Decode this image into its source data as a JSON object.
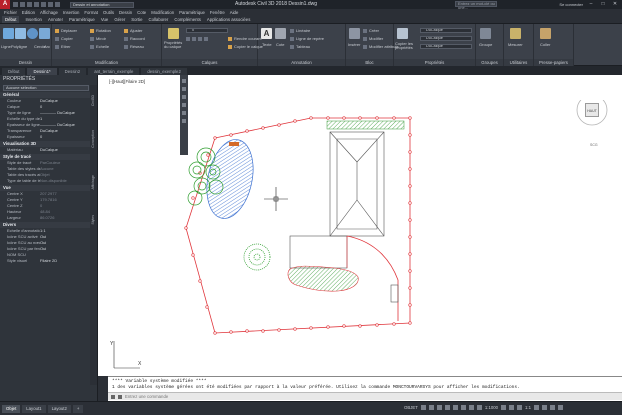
{
  "titlebar": {
    "logo": "A",
    "workspace": "Dessin et annotation",
    "title": "Autodesk Civil 3D 2018   Dessin1.dwg",
    "search_placeholder": "Entrez un mot-clé ou une...",
    "signin": "Se connecter"
  },
  "menubar": [
    "Fichier",
    "Edition",
    "Affichage",
    "Insertion",
    "Format",
    "Outils",
    "Dessin",
    "Cote",
    "Modification",
    "Paramétrique",
    "Fenêtre",
    "Aide"
  ],
  "ribbon_tabs": [
    "Début",
    "Insertion",
    "Annoter",
    "Paramétrique",
    "Vue",
    "Gérer",
    "Sortie",
    "Collaborer",
    "Compléments",
    "Applications associées"
  ],
  "ribbon": {
    "dessin": {
      "title": "Dessin",
      "items": [
        "Ligne",
        "Polyligne",
        "Cercle",
        "Arc"
      ]
    },
    "modification": {
      "title": "Modification",
      "items": [
        "Déplacer",
        "Rotation",
        "Ajuster",
        "Copier",
        "Miroir",
        "Raccord",
        "Etirer",
        "Echelle",
        "Réseau"
      ]
    },
    "calques": {
      "title": "Calques",
      "items": [
        "Propriétés du calque",
        "Rendre courant",
        "Copier le calque"
      ],
      "combo": "0"
    },
    "annotation": {
      "title": "Annotation",
      "items": [
        "Texte",
        "Cote",
        "Linéaire",
        "Ligne de repère",
        "Tableau"
      ]
    },
    "bloc": {
      "title": "Bloc",
      "items": [
        "Insérer",
        "Créer",
        "Modifier",
        "Modifier attributs"
      ]
    },
    "proprietes": {
      "title": "Propriétés",
      "items": [
        "Copier les propriétés"
      ],
      "combos": [
        "DuCalque",
        "DuCalque",
        "DuCalque"
      ]
    },
    "groupes": {
      "title": "Groupes",
      "items": [
        "Groupe"
      ]
    },
    "utilitaires": {
      "title": "Utilitaires",
      "items": [
        "Mesurer"
      ]
    },
    "presse": {
      "title": "Presse-papiers",
      "items": [
        "Coller"
      ]
    }
  },
  "doctabs": [
    "Début",
    "Dessin1*",
    "Dessin2",
    "ant_terrain_exemple",
    "dessin_exemple2"
  ],
  "properties": {
    "header": "PROPRIÉTÉS",
    "selection": "Aucune sélection",
    "sections": [
      {
        "title": "Général",
        "rows": [
          {
            "k": "Couleur",
            "v": "DuCalque"
          },
          {
            "k": "Calque",
            "v": "0"
          },
          {
            "k": "Type de ligne",
            "v": "———— DuCalque"
          },
          {
            "k": "Echelle du type de li...",
            "v": "1"
          },
          {
            "k": "Epaisseur de ligne",
            "v": "———— DuCalque"
          },
          {
            "k": "Transparence",
            "v": "DuCalque"
          },
          {
            "k": "Epaisseur",
            "v": "0"
          }
        ]
      },
      {
        "title": "Visualisation 3D",
        "rows": [
          {
            "k": "Matériau",
            "v": "DuCalque"
          }
        ]
      },
      {
        "title": "Style de tracé",
        "rows": [
          {
            "k": "Style de tracé",
            "v": "ParCouleur"
          },
          {
            "k": "Table des styles de tr...",
            "v": "Aucune"
          },
          {
            "k": "Table des tracés atta...",
            "v": "Objet"
          },
          {
            "k": "Type de table de tra...",
            "v": "Non-disponible"
          }
        ]
      },
      {
        "title": "Vue",
        "rows": [
          {
            "k": "Centre X",
            "v": "207.2977"
          },
          {
            "k": "Centre Y",
            "v": "179.7816"
          },
          {
            "k": "Centre Z",
            "v": "0"
          },
          {
            "k": "Hauteur",
            "v": "48.84"
          },
          {
            "k": "Largeur",
            "v": "86.0726"
          }
        ]
      },
      {
        "title": "Divers",
        "rows": [
          {
            "k": "Echelle d'annotation",
            "v": "1:1"
          },
          {
            "k": "Icône SCU activé",
            "v": "Oui"
          },
          {
            "k": "Icône SCU au nœud...",
            "v": "Oui"
          },
          {
            "k": "Icône SCU par fenêt...",
            "v": "Oui"
          },
          {
            "k": "NOM SCU",
            "v": ""
          },
          {
            "k": "Style visuel",
            "v": "Filaire 2D"
          }
        ]
      }
    ],
    "side_tabs": [
      "Civil3D",
      "Conception",
      "Affichage",
      "Styles"
    ]
  },
  "drawing": {
    "view_label": "[-][Haut][Filaire 2D]",
    "viewcube_face": "HAUT",
    "wcs": "SCG"
  },
  "command": {
    "lines": [
      "**** Variable système modifiée ****",
      "1 des variables système gérées ont été modifiées par rapport à la valeur préférée. Utilisez la commande MONCTOURVARSYS pour afficher les modifications."
    ],
    "placeholder": "Entrez une commande"
  },
  "status": {
    "layout_tabs": [
      "Objet",
      "Layout1",
      "Layout2",
      "+"
    ],
    "mode": "OBJET",
    "scale": "1:1000",
    "zoom": "1:1"
  },
  "colors": {
    "boundary_red": "#e0363c",
    "hatch_green": "#3a9a3a",
    "hatch_blue": "#3a6fd0",
    "tree_green": "#2e9e2e",
    "orange": "#d46a28"
  }
}
